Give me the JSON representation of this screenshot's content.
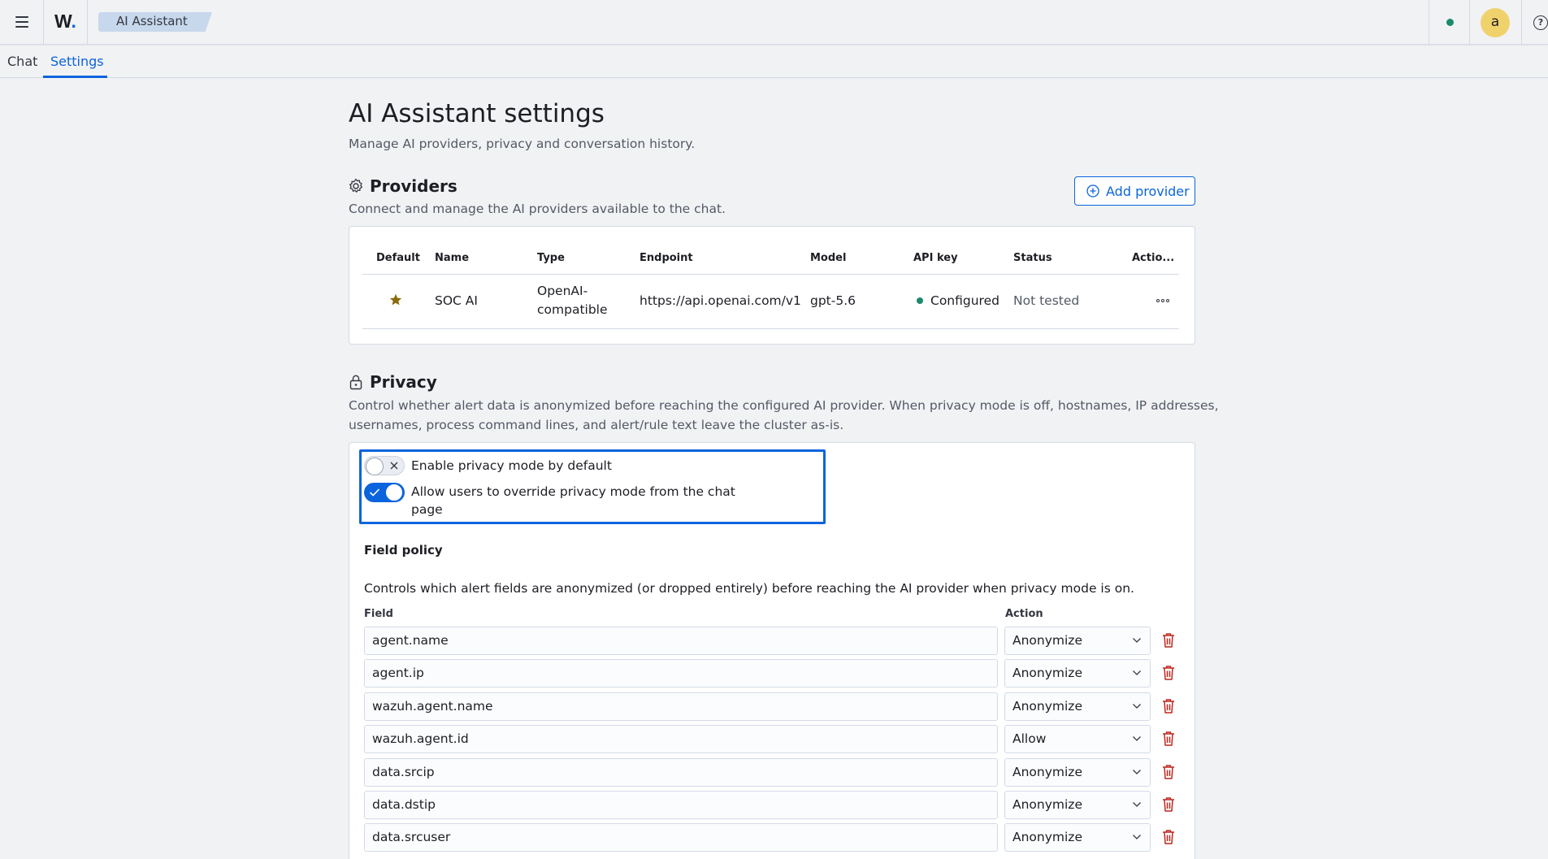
{
  "header": {
    "logo_text": "W",
    "logo_dot": ".",
    "breadcrumb": "AI Assistant",
    "avatar_initial": "a",
    "help_glyph": "?"
  },
  "tabs": [
    {
      "label": "Chat",
      "active": false
    },
    {
      "label": "Settings",
      "active": true
    }
  ],
  "page": {
    "title": "AI Assistant settings",
    "subtitle": "Manage AI providers, privacy and conversation history."
  },
  "providers": {
    "title": "Providers",
    "description": "Connect and manage the AI providers available to the chat.",
    "add_button": "Add provider",
    "columns": [
      "Default",
      "Name",
      "Type",
      "Endpoint",
      "Model",
      "API key",
      "Status",
      "Actio..."
    ],
    "rows": [
      {
        "default": true,
        "name": "SOC AI",
        "type_line1": "OpenAI-",
        "type_line2": "compatible",
        "endpoint": "https://api.openai.com/v1",
        "model": "gpt-5.6",
        "api_key": "Configured",
        "status": "Not tested"
      }
    ]
  },
  "privacy": {
    "title": "Privacy",
    "description_line1": "Control whether alert data is anonymized before reaching the configured AI provider. When privacy mode is off, hostnames, IP addresses,",
    "description_line2": "usernames, process command lines, and alert/rule text leave the cluster as-is.",
    "toggles": [
      {
        "label": "Enable privacy mode by default",
        "checked": false
      },
      {
        "label_line1": "Allow users to override privacy mode from the chat",
        "label_line2": "page",
        "checked": true
      }
    ],
    "field_policy": {
      "title": "Field policy",
      "description": "Controls which alert fields are anonymized (or dropped entirely) before reaching the AI provider when privacy mode is on.",
      "field_label": "Field",
      "action_label": "Action",
      "rows": [
        {
          "field": "agent.name",
          "action": "Anonymize"
        },
        {
          "field": "agent.ip",
          "action": "Anonymize"
        },
        {
          "field": "wazuh.agent.name",
          "action": "Anonymize"
        },
        {
          "field": "wazuh.agent.id",
          "action": "Allow"
        },
        {
          "field": "data.srcip",
          "action": "Anonymize"
        },
        {
          "field": "data.dstip",
          "action": "Anonymize"
        },
        {
          "field": "data.srcuser",
          "action": "Anonymize"
        }
      ]
    }
  },
  "colors": {
    "accent": "#0b64dd",
    "success": "#1a8a6b",
    "danger": "#bd271e",
    "star": "#8a6a0a"
  }
}
